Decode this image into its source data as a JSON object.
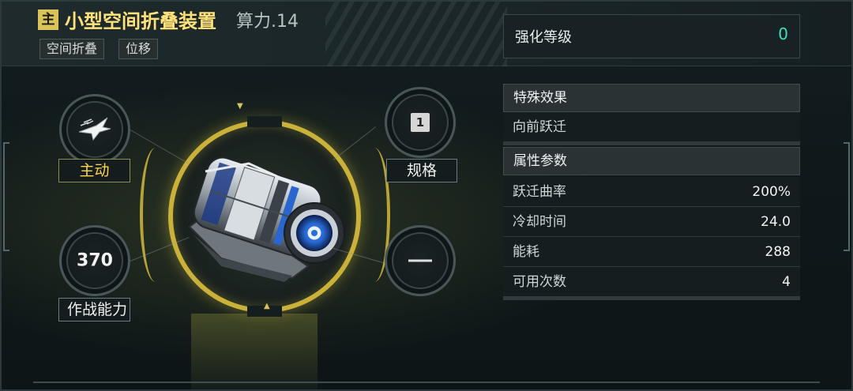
{
  "header": {
    "badge": "主",
    "title": "小型空间折叠装置",
    "power": "算力.14",
    "tags": [
      "空间折叠",
      "位移"
    ]
  },
  "enhance": {
    "label": "强化等级",
    "value": "0"
  },
  "left_slots": {
    "mode_label": "主动",
    "combat_value": "370",
    "combat_label": "作战能力"
  },
  "right_slots": {
    "spec_value": "1",
    "spec_label": "规格"
  },
  "special": {
    "heading": "特殊效果",
    "effect": "向前跃迁"
  },
  "attributes": {
    "heading": "属性参数",
    "rows": [
      {
        "key": "跃迁曲率",
        "value": "200%"
      },
      {
        "key": "冷却时间",
        "value": "24.0"
      },
      {
        "key": "能耗",
        "value": "288"
      },
      {
        "key": "可用次数",
        "value": "4"
      }
    ]
  },
  "colors": {
    "title_gold": "#ffe27a",
    "ring_gold": "#c9b13a",
    "enhance_teal": "#3fe0c0",
    "active_yellow": "#ffd54a"
  }
}
